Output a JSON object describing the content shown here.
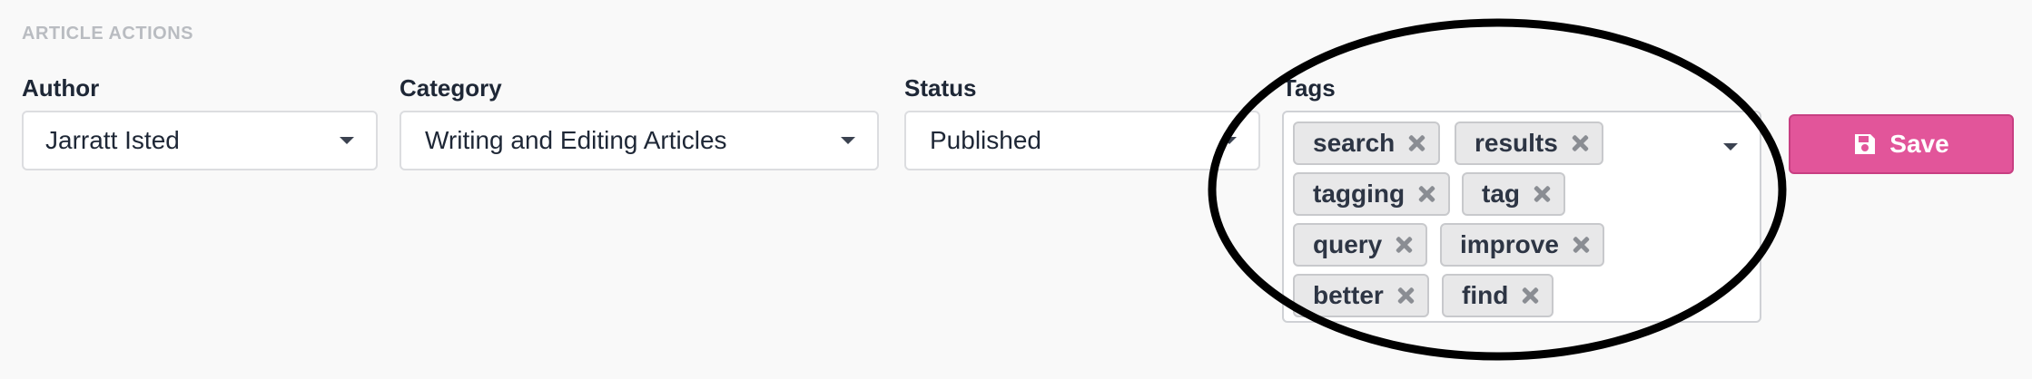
{
  "section": {
    "title": "ARTICLE ACTIONS"
  },
  "author": {
    "label": "Author",
    "value": "Jarratt Isted"
  },
  "category": {
    "label": "Category",
    "value": "Writing and Editing Articles"
  },
  "status": {
    "label": "Status",
    "value": "Published"
  },
  "tags": {
    "label": "Tags",
    "items": [
      {
        "label": "search"
      },
      {
        "label": "results"
      },
      {
        "label": "tagging"
      },
      {
        "label": "tag"
      },
      {
        "label": "query"
      },
      {
        "label": "improve"
      },
      {
        "label": "better"
      },
      {
        "label": "find"
      }
    ]
  },
  "save": {
    "label": "Save",
    "icon": "floppy-disk-icon"
  },
  "colors": {
    "accent": "#e2559a",
    "background": "#f9f9f9",
    "annotation": "#000000"
  }
}
